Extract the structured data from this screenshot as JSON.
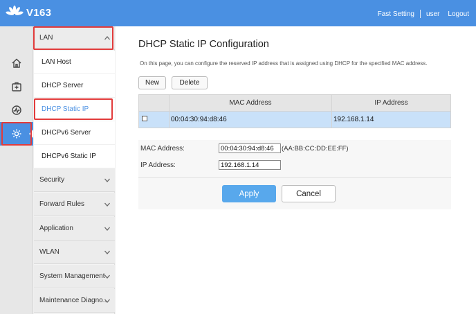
{
  "header": {
    "brand": "V163",
    "links": {
      "fast_setting": "Fast Setting",
      "user": "user",
      "logout": "Logout"
    }
  },
  "colors": {
    "header": "#4a90e2",
    "accent": "#4a90e2",
    "highlight_box": "#e23b3b",
    "selected_row": "#c9e1f9",
    "apply_button": "#58a8ec"
  },
  "rail": {
    "items": [
      {
        "icon": "home-icon"
      },
      {
        "icon": "first-aid-icon"
      },
      {
        "icon": "speedometer-icon"
      },
      {
        "icon": "gear-icon",
        "active": true
      }
    ]
  },
  "menu": {
    "lan": {
      "label": "LAN",
      "subitems": [
        "LAN Host",
        "DHCP Server",
        "DHCP Static IP",
        "DHCPv6 Server",
        "DHCPv6 Static IP"
      ]
    },
    "sections": [
      "Security",
      "Forward Rules",
      "Application",
      "WLAN",
      "System Management",
      "Maintenance Diagno.."
    ]
  },
  "page": {
    "title": "DHCP Static IP Configuration",
    "description": "On this page, you can configure the reserved IP address that is assigned using DHCP for the specified MAC address.",
    "buttons": {
      "new": "New",
      "delete": "Delete"
    },
    "table": {
      "headers": [
        "MAC Address",
        "IP Address"
      ],
      "rows": [
        {
          "mac": "00:04:30:94:d8:46",
          "ip": "192.168.1.14"
        }
      ]
    },
    "form": {
      "mac_label": "MAC Address:",
      "mac_value": "00:04:30:94:d8:46",
      "mac_hint": "(AA:BB:CC:DD:EE:FF)",
      "ip_label": "IP Address:",
      "ip_value": "192.168.1.14"
    },
    "actions": {
      "apply": "Apply",
      "cancel": "Cancel"
    }
  }
}
